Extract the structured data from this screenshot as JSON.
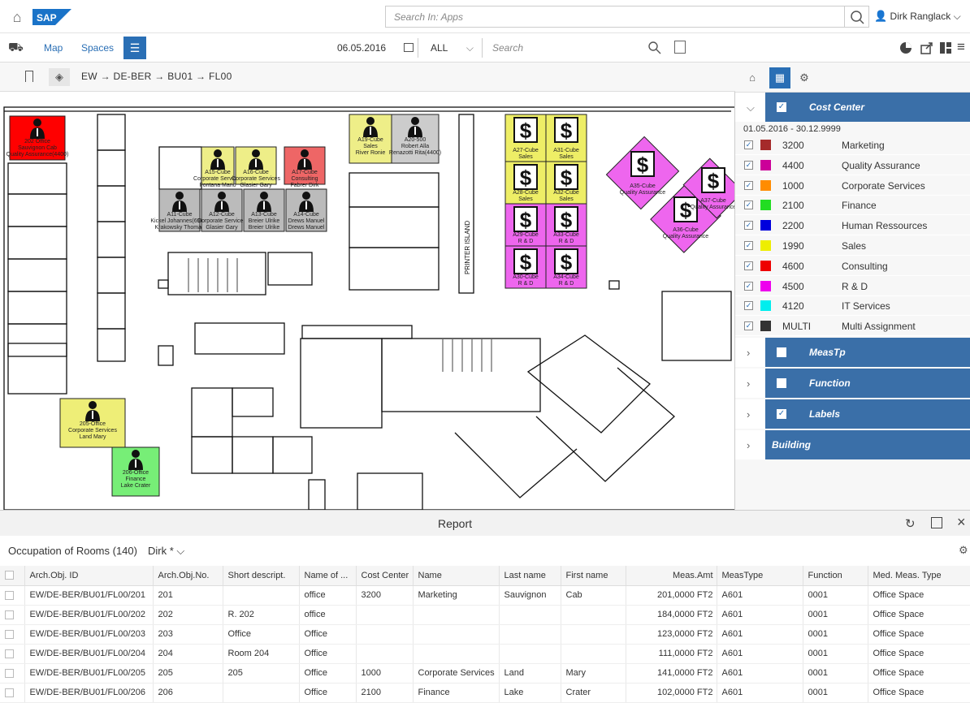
{
  "shell": {
    "search_placeholder": "Search In: Apps",
    "user_name": "Dirk Ranglack",
    "logo_text": "SAP"
  },
  "toolbar": {
    "map_label": "Map",
    "spaces_label": "Spaces",
    "date": "06.05.2016",
    "filter_value": "ALL",
    "search_placeholder": "Search"
  },
  "breadcrumb": {
    "path": "EW  →  DE-BER  →  BU01  →  FL00"
  },
  "floor": {
    "rooms": [
      {
        "id": "r202",
        "lines": [
          "202 Office",
          "Sauvignon Cab",
          "Quality Assurance(4400)"
        ],
        "color": "#ff0000"
      },
      {
        "id": "rA15",
        "lines": [
          "A15-Cube",
          "Corporate Services",
          "Fontana Mario"
        ],
        "color": "#eeee88"
      },
      {
        "id": "rA16",
        "lines": [
          "A16-Cube",
          "Corporate Services",
          "Glasier Gary"
        ],
        "color": "#eeee88"
      },
      {
        "id": "rA17",
        "lines": [
          "A17-Cube",
          "Consulting",
          "Fabrer Dirk"
        ],
        "color": "#ee6666"
      },
      {
        "id": "rA11",
        "lines": [
          "A11-Cube",
          "Kickel Johannes(6900)",
          "Krakowsky Thomas"
        ],
        "color": "#bbbbbb"
      },
      {
        "id": "rA12",
        "lines": [
          "A12-Cube",
          "Corporate Services",
          "Glasier Gary"
        ],
        "color": "#bbbbbb"
      },
      {
        "id": "rA13",
        "lines": [
          "A13-Cube",
          "Breier Ulrike",
          "Breier Ulrike"
        ],
        "color": "#bbbbbb"
      },
      {
        "id": "rA14",
        "lines": [
          "A14-Cube",
          "Drews Manuel",
          "Drews Manuel"
        ],
        "color": "#bbbbbb"
      },
      {
        "id": "rA19",
        "lines": [
          "A19-Cube",
          "Sales",
          "River Ronie"
        ],
        "color": "#eeee88"
      },
      {
        "id": "rA20",
        "lines": [
          "A20-500",
          "Robert Alla",
          "Renazotti Rita(4400)"
        ],
        "color": "#cccccc"
      },
      {
        "id": "rA27",
        "lines": [
          "A27-Cube",
          "Sales"
        ],
        "color": "#eeee66"
      },
      {
        "id": "rA31",
        "lines": [
          "A31-Cube",
          "Sales"
        ],
        "color": "#eeee66"
      },
      {
        "id": "rA28",
        "lines": [
          "A28-Cube",
          "Sales"
        ],
        "color": "#eeee66"
      },
      {
        "id": "rA32",
        "lines": [
          "A32-Cube",
          "Sales"
        ],
        "color": "#eeee66"
      },
      {
        "id": "rA29",
        "lines": [
          "A29-Cube",
          "R & D"
        ],
        "color": "#ee66ee"
      },
      {
        "id": "rA33",
        "lines": [
          "A33-Cube",
          "R & D"
        ],
        "color": "#ee66ee"
      },
      {
        "id": "rA30",
        "lines": [
          "A30-Cube",
          "R & D"
        ],
        "color": "#ee66ee"
      },
      {
        "id": "rA34",
        "lines": [
          "A34-Cube",
          "R & D"
        ],
        "color": "#ee66ee"
      },
      {
        "id": "rA35",
        "lines": [
          "A35-Cube",
          "Quality Assurance"
        ],
        "color": "#ee66ee"
      },
      {
        "id": "rA36",
        "lines": [
          "A36-Cube",
          "Quality Assurance"
        ],
        "color": "#ee66ee"
      },
      {
        "id": "rA37",
        "lines": [
          "A37-Cube",
          "Quality Assurance"
        ],
        "color": "#ee66ee"
      },
      {
        "id": "r205",
        "lines": [
          "205-Office",
          "Corporate Services",
          "Land Mary"
        ],
        "color": "#eeee77"
      },
      {
        "id": "r206",
        "lines": [
          "206-Office",
          "Finance",
          "Lake Crater"
        ],
        "color": "#77ee77"
      }
    ],
    "printer_label": "PRINTER ISLAND"
  },
  "panel": {
    "cost_center_label": "Cost Center",
    "date_range": "01.05.2016 - 30.12.9999",
    "cost_centers": [
      {
        "code": "3200",
        "name": "Marketing",
        "color": "#a52a2a"
      },
      {
        "code": "4400",
        "name": "Quality Assurance",
        "color": "#cc0099"
      },
      {
        "code": "1000",
        "name": "Corporate Services",
        "color": "#ff8c00"
      },
      {
        "code": "2100",
        "name": "Finance",
        "color": "#22dd22"
      },
      {
        "code": "2200",
        "name": "Human Ressources",
        "color": "#0000dd"
      },
      {
        "code": "1990",
        "name": "Sales",
        "color": "#eeee00"
      },
      {
        "code": "4600",
        "name": "Consulting",
        "color": "#ee0000"
      },
      {
        "code": "4500",
        "name": "R & D",
        "color": "#ee00ee"
      },
      {
        "code": "4120",
        "name": "IT Services",
        "color": "#00eeee"
      },
      {
        "code": "MULTI",
        "name": "Multi Assignment",
        "color": "#333333"
      }
    ],
    "meastp_label": "MeasTp",
    "function_label": "Function",
    "labels_label": "Labels",
    "building_label": "Building"
  },
  "report": {
    "title": "Report",
    "occupation_title": "Occupation of Rooms (140)",
    "variant": "Dirk *",
    "columns": [
      "Arch.Obj. ID",
      "Arch.Obj.No.",
      "Short descript.",
      "Name of ...",
      "Cost Center",
      "Name",
      "Last name",
      "First name",
      "Meas.Amt",
      "MeasType",
      "Function",
      "Med. Meas. Type"
    ],
    "rows": [
      [
        "EW/DE-BER/BU01/FL00/201",
        "201",
        "",
        "office",
        "3200",
        "Marketing",
        "Sauvignon",
        "Cab",
        "201,0000  FT2",
        "A601",
        "0001",
        "Office Space"
      ],
      [
        "EW/DE-BER/BU01/FL00/202",
        "202",
        "R. 202",
        "office",
        "",
        "",
        "",
        "",
        "184,0000  FT2",
        "A601",
        "0001",
        "Office Space"
      ],
      [
        "EW/DE-BER/BU01/FL00/203",
        "203",
        "Office",
        "Office",
        "",
        "",
        "",
        "",
        "123,0000  FT2",
        "A601",
        "0001",
        "Office Space"
      ],
      [
        "EW/DE-BER/BU01/FL00/204",
        "204",
        "Room 204",
        "Office",
        "",
        "",
        "",
        "",
        "111,0000  FT2",
        "A601",
        "0001",
        "Office Space"
      ],
      [
        "EW/DE-BER/BU01/FL00/205",
        "205",
        "205",
        "Office",
        "1000",
        "Corporate Services",
        "Land",
        "Mary",
        "141,0000  FT2",
        "A601",
        "0001",
        "Office Space"
      ],
      [
        "EW/DE-BER/BU01/FL00/206",
        "206",
        "",
        "Office",
        "2100",
        "Finance",
        "Lake",
        "Crater",
        "102,0000  FT2",
        "A601",
        "0001",
        "Office Space"
      ]
    ]
  }
}
